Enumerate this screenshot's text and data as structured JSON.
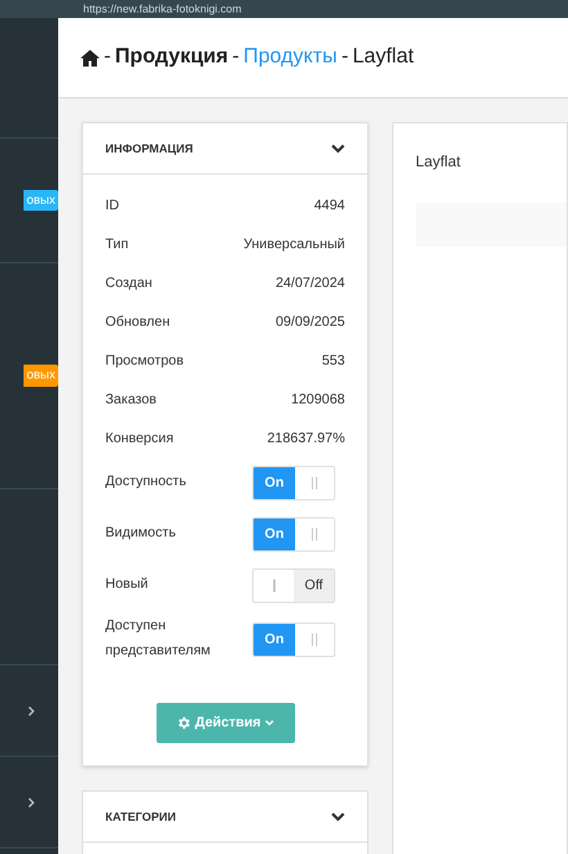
{
  "top_bar": {
    "url": "https://new.fabrika-fotoknigi.com"
  },
  "sidebar": {
    "items": [
      {
        "kind": "badge",
        "badge": "овых",
        "color": "#29b6f6"
      },
      {
        "kind": "badge",
        "badge": "овых",
        "color": "#ff9800"
      },
      {
        "kind": "blank"
      },
      {
        "kind": "expandable"
      },
      {
        "kind": "expandable"
      }
    ]
  },
  "breadcrumb_separator": "-",
  "breadcrumb": [
    {
      "label": "Продукция",
      "kind": "current"
    },
    {
      "label": "Продукты",
      "kind": "link"
    },
    {
      "label": "Layflat",
      "kind": "plain"
    }
  ],
  "info": {
    "title": "ИНФОРМАЦИЯ",
    "rows": [
      {
        "label": "ID",
        "value": "4494"
      },
      {
        "label": "Тип",
        "value": "Универсальный"
      },
      {
        "label": "Создан",
        "value": "24/07/2024"
      },
      {
        "label": "Обновлен",
        "value": "09/09/2025"
      },
      {
        "label": "Просмотров",
        "value": "553"
      },
      {
        "label": "Заказов",
        "value": "1209068"
      },
      {
        "label": "Конверсия",
        "value": "218637.97%"
      }
    ],
    "toggles": [
      {
        "label": "Доступность",
        "on": true,
        "text": "On"
      },
      {
        "label": "Видимость",
        "on": true,
        "text": "On"
      },
      {
        "label": "Новый",
        "on": false,
        "text": "Off"
      },
      {
        "label": "Доступен представителям",
        "on": true,
        "text": "On"
      }
    ],
    "action_button": "Действия"
  },
  "categories": {
    "title": "КАТЕГОРИИ"
  },
  "main_card": {
    "title": "Layflat"
  }
}
